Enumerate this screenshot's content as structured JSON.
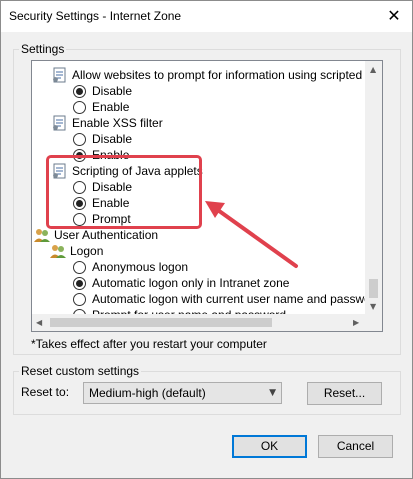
{
  "window": {
    "title": "Security Settings - Internet Zone",
    "close_glyph": "✕"
  },
  "settings_group": {
    "label": "Settings"
  },
  "tree": {
    "items": [
      {
        "kind": "header",
        "icon": "settings-page-icon",
        "label": "Allow websites to prompt for information using scripted windo"
      },
      {
        "kind": "radio",
        "label": "Disable",
        "checked": true
      },
      {
        "kind": "radio",
        "label": "Enable",
        "checked": false
      },
      {
        "kind": "header",
        "icon": "settings-page-icon",
        "label": "Enable XSS filter"
      },
      {
        "kind": "radio",
        "label": "Disable",
        "checked": false
      },
      {
        "kind": "radio",
        "label": "Enable",
        "checked": true
      },
      {
        "kind": "header",
        "icon": "settings-page-icon",
        "label": "Scripting of Java applets"
      },
      {
        "kind": "radio",
        "label": "Disable",
        "checked": false
      },
      {
        "kind": "radio",
        "label": "Enable",
        "checked": true
      },
      {
        "kind": "radio",
        "label": "Prompt",
        "checked": false
      },
      {
        "kind": "category",
        "icon": "users-icon",
        "label": "User Authentication"
      },
      {
        "kind": "header",
        "icon": "users-icon",
        "label": "Logon"
      },
      {
        "kind": "radio",
        "label": "Anonymous logon",
        "checked": false
      },
      {
        "kind": "radio",
        "label": "Automatic logon only in Intranet zone",
        "checked": true
      },
      {
        "kind": "radio",
        "label": "Automatic logon with current user name and password",
        "checked": false
      },
      {
        "kind": "radio",
        "label": "Prompt for user name and password",
        "checked": false
      }
    ]
  },
  "note": "*Takes effect after you restart your computer",
  "reset_group": {
    "label": "Reset custom settings",
    "reset_to_label": "Reset to:",
    "selected_level": "Medium-high (default)",
    "reset_button": "Reset..."
  },
  "footer": {
    "ok_label": "OK",
    "cancel_label": "Cancel"
  },
  "colors": {
    "highlight": "#e0414d",
    "accent": "#0078d7"
  }
}
